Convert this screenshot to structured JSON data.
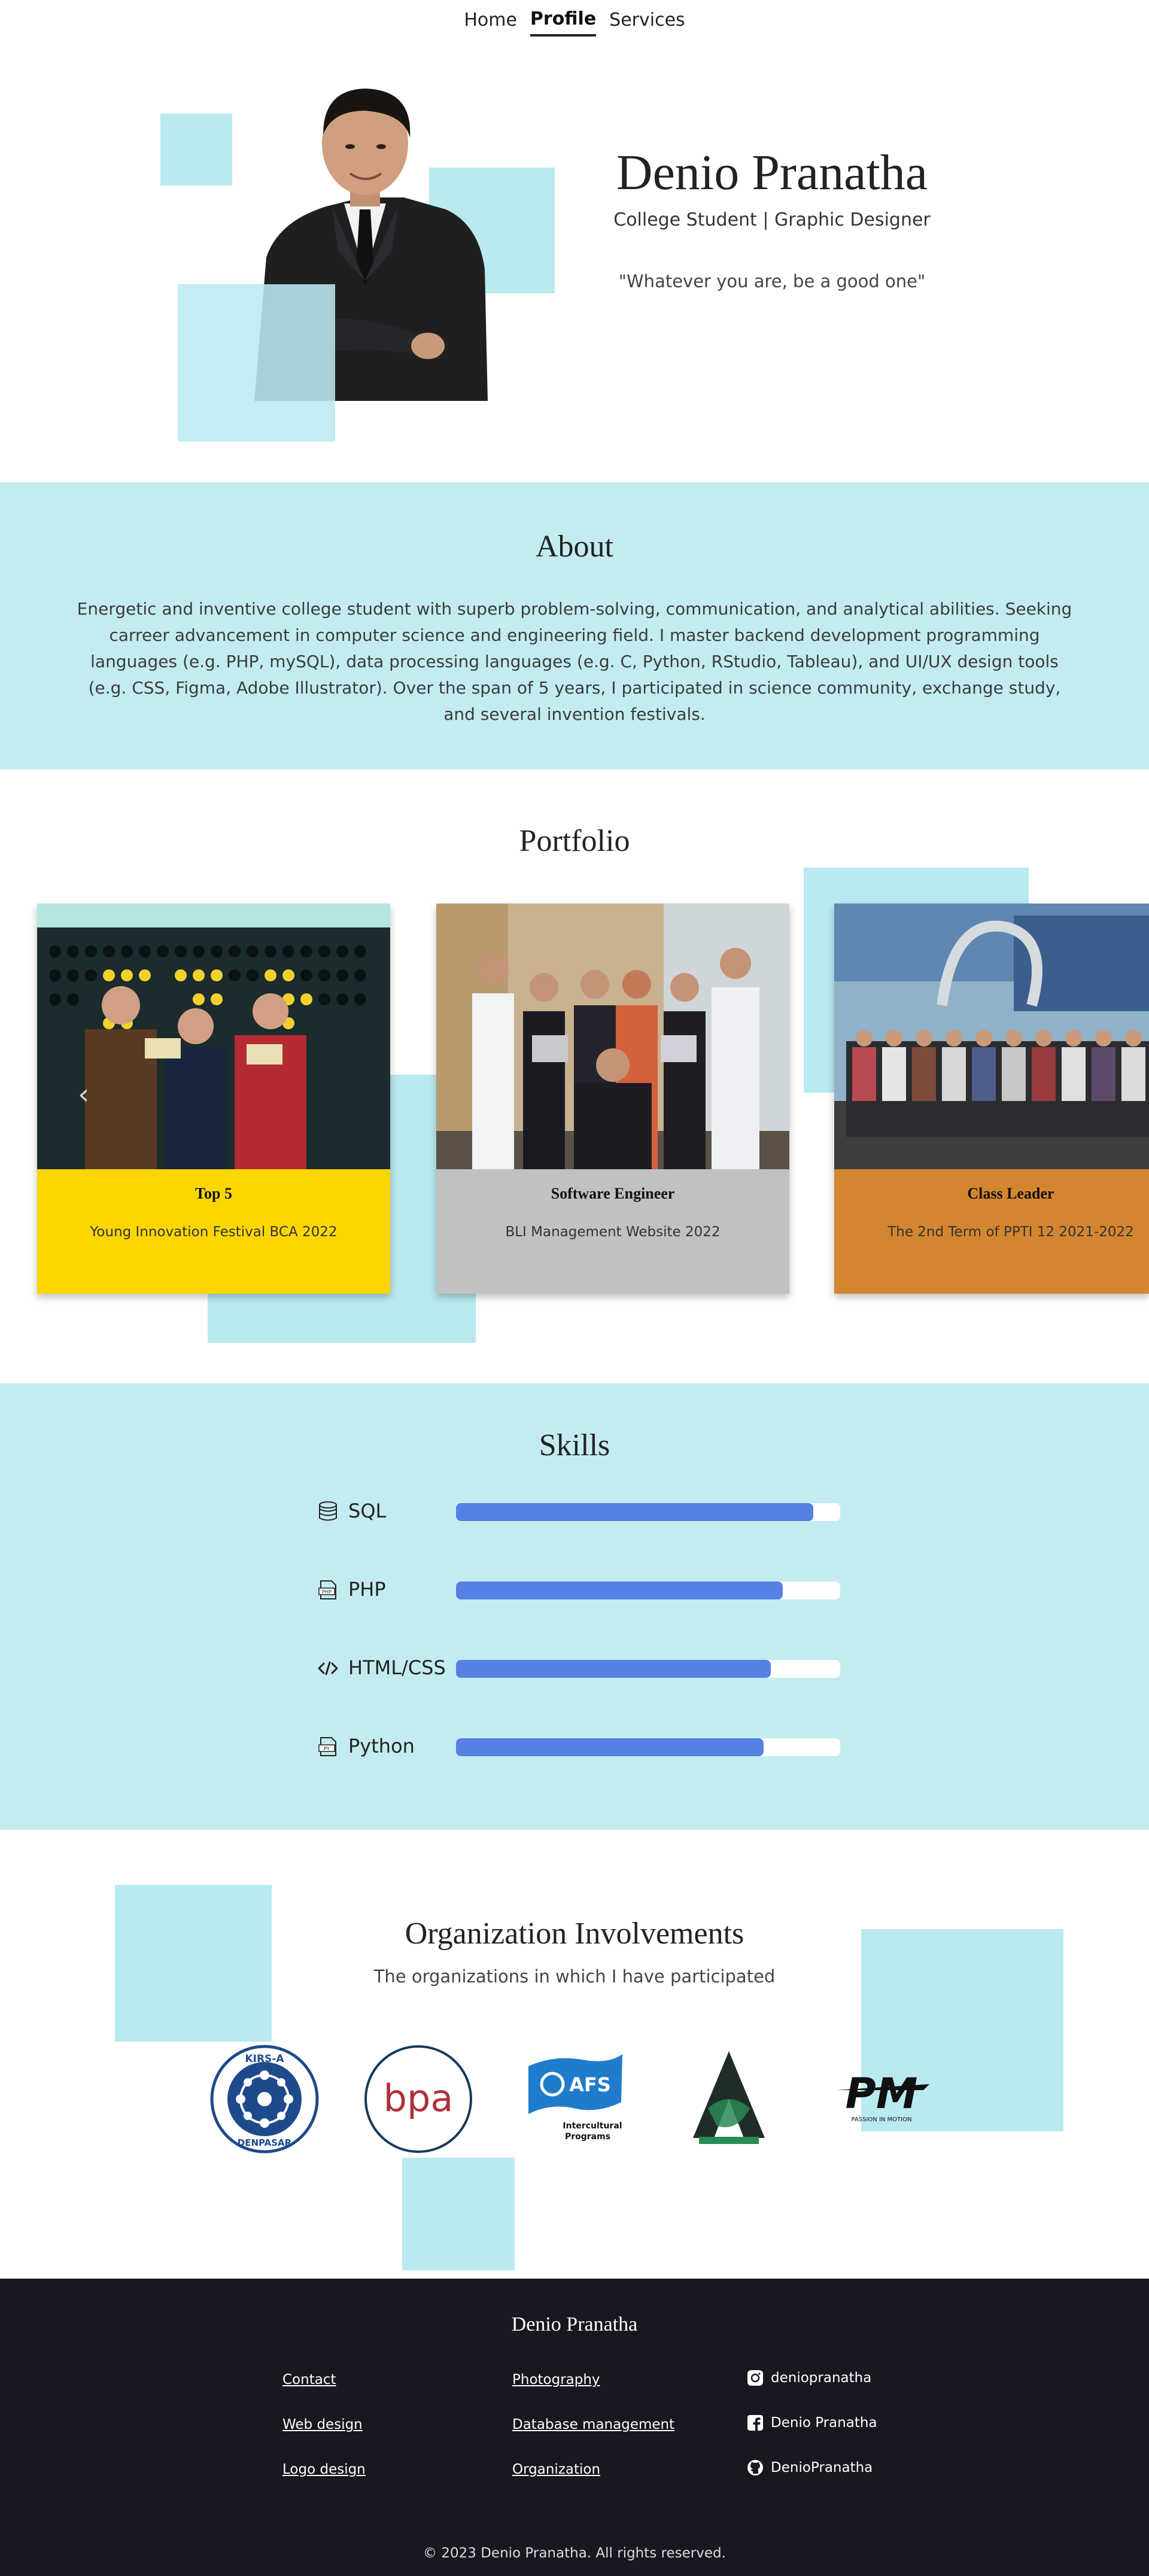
{
  "nav": {
    "items": [
      {
        "label": "Home",
        "active": false
      },
      {
        "label": "Profile",
        "active": true
      },
      {
        "label": "Services",
        "active": false
      }
    ]
  },
  "hero": {
    "name": "Denio Pranatha",
    "subtitle": "College Student | Graphic Designer",
    "quote": "\"Whatever you are, be a good one\""
  },
  "about": {
    "title": "About",
    "text": "Energetic and inventive college student with superb problem-solving, communication, and analytical abilities. Seeking carreer advancement in computer science and engineering field. I master backend development programming languages (e.g. PHP, mySQL), data processing languages (e.g. C, Python, RStudio, Tableau), and UI/UX design tools (e.g. CSS, Figma, Adobe Illustrator). Over the span of 5 years, I participated in science community, exchange study, and several invention festivals."
  },
  "portfolio": {
    "title": "Portfolio",
    "prev_icon": "chevron-left-icon",
    "cards": [
      {
        "title": "Top 5",
        "subtitle": "Young Innovation Festival BCA 2022",
        "color": "#fdd600"
      },
      {
        "title": "Software Engineer",
        "subtitle": "BLI Management Website 2022",
        "color": "#c1c1c1"
      },
      {
        "title": "Class Leader",
        "subtitle": "The 2nd Term of PPTI 12 2021-2022",
        "color": "#d3862f"
      }
    ]
  },
  "skills": {
    "title": "Skills",
    "items": [
      {
        "label": "SQL",
        "icon": "database-icon",
        "level": 0.93
      },
      {
        "label": "PHP",
        "icon": "php-file-icon",
        "level": 0.85
      },
      {
        "label": "HTML/CSS",
        "icon": "code-icon",
        "level": 0.82
      },
      {
        "label": "Python",
        "icon": "python-file-icon",
        "level": 0.8
      }
    ],
    "bar_color": "#5580e5"
  },
  "orgs": {
    "title": "Organization Involvements",
    "subtitle": "The organizations in which I have participated",
    "logos": [
      {
        "name": "kirs-a-logo",
        "text_top": "KIRS-A",
        "text_bottom": "DENPASAR"
      },
      {
        "name": "bpa-logo",
        "text": "bpa"
      },
      {
        "name": "afs-logo",
        "text": "AFS",
        "caption_1": "Intercultural",
        "caption_2": "Programs"
      },
      {
        "name": "a-emblem-logo",
        "text": "A"
      },
      {
        "name": "pm-logo",
        "text": "PM",
        "caption": "PASSION IN MOTION"
      }
    ]
  },
  "footer": {
    "name": "Denio Pranatha",
    "col1": [
      "Contact",
      "Web design",
      "Logo design"
    ],
    "col2": [
      "Photography",
      "Database management",
      "Organization"
    ],
    "social": [
      {
        "icon": "instagram-icon",
        "label": "deniopranatha"
      },
      {
        "icon": "facebook-icon",
        "label": "Denio Pranatha"
      },
      {
        "icon": "github-icon",
        "label": "DenioPranatha"
      }
    ],
    "copyright": "© 2023 Denio Pranatha. All rights reserved."
  },
  "colors": {
    "accent_light": "#c3ecf1",
    "accent_square": "#b9eaf0",
    "footer_bg": "#181821"
  }
}
